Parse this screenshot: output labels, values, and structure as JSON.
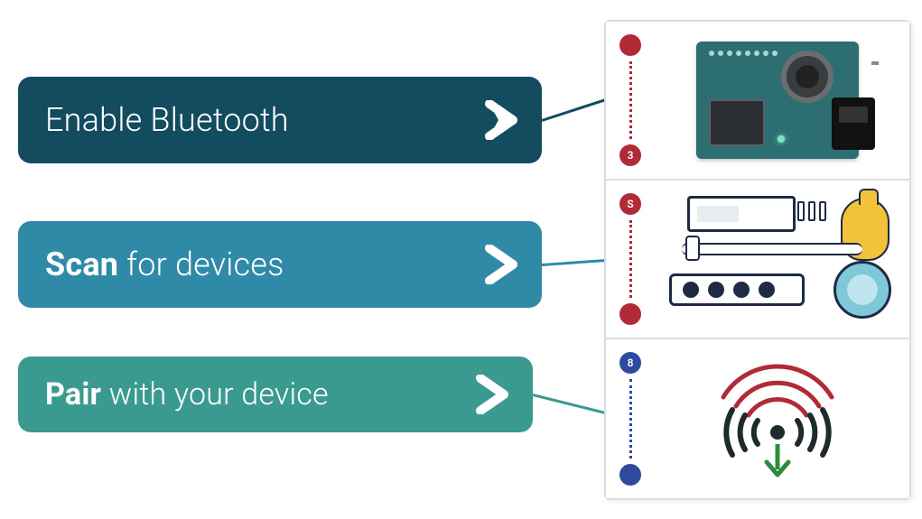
{
  "steps": [
    {
      "label_prefix": "",
      "label_main": "Enable Bluetooth",
      "label_suffix": ""
    },
    {
      "label_prefix": "Scan",
      "label_main": "",
      "label_suffix": " for devices"
    },
    {
      "label_prefix": "Pair",
      "label_main": "",
      "label_suffix": " with your device"
    }
  ],
  "panels": [
    {
      "top_marker": "",
      "bottom_marker": "3",
      "marker_color": "red"
    },
    {
      "top_marker": "S",
      "bottom_marker": "",
      "marker_color": "red"
    },
    {
      "top_marker": "8",
      "bottom_marker": "",
      "marker_color": "blue"
    }
  ]
}
